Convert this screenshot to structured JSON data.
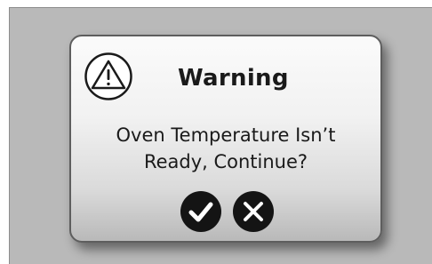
{
  "dialog": {
    "title": "Warning",
    "message_line1": "Oven Temperature Isn’t",
    "message_line2": "Ready, Continue?",
    "icon": "warning-triangle-icon",
    "buttons": [
      {
        "icon": "checkmark-icon",
        "action": "confirm"
      },
      {
        "icon": "close-x-icon",
        "action": "cancel"
      }
    ]
  },
  "colors": {
    "screen_background": "#b9b9b9",
    "dialog_border": "#5e5e5e",
    "button_fill": "#141414",
    "button_glyph": "#ffffff",
    "text": "#1a1a1a"
  }
}
